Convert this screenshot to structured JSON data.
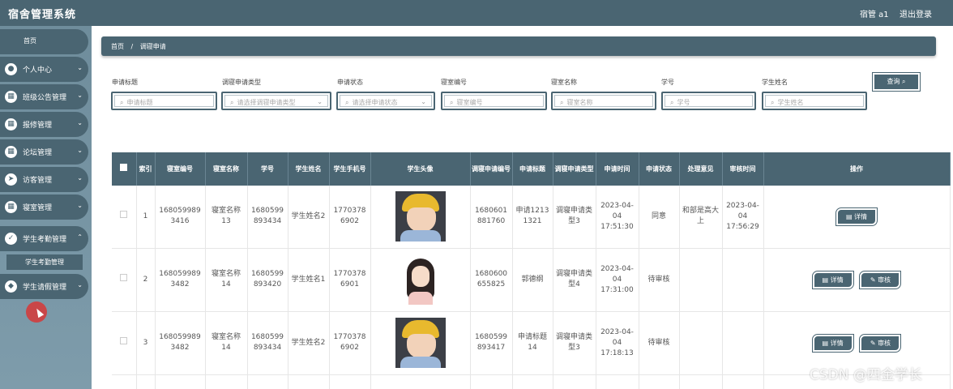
{
  "app": {
    "title": "宿舍管理系统",
    "user": "宿管 a1",
    "logout": "退出登录"
  },
  "sidebar": {
    "home": "首页",
    "items": [
      {
        "label": "个人中心",
        "icon": "person-icon"
      },
      {
        "label": "班级公告管理",
        "icon": "grid-icon"
      },
      {
        "label": "报修管理",
        "icon": "grid-icon"
      },
      {
        "label": "论坛管理",
        "icon": "grid-icon"
      },
      {
        "label": "访客管理",
        "icon": "send-icon"
      },
      {
        "label": "寝室管理",
        "icon": "grid-icon"
      },
      {
        "label": "学生考勤管理",
        "icon": "check-icon"
      },
      {
        "label": "学生请假管理",
        "icon": "shield-icon"
      }
    ],
    "submenu": "学生考勤管理"
  },
  "breadcrumb": {
    "home": "首页",
    "sep": "/",
    "current": "调寝申请"
  },
  "search": {
    "fields": [
      {
        "label": "申请标题",
        "placeholder": "申请标题"
      },
      {
        "label": "调寝申请类型",
        "placeholder": "请选择调寝申请类型"
      },
      {
        "label": "申请状态",
        "placeholder": "请选择申请状态"
      },
      {
        "label": "寝室编号",
        "placeholder": "寝室编号"
      },
      {
        "label": "寝室名称",
        "placeholder": "寝室名称"
      },
      {
        "label": "学号",
        "placeholder": "学号"
      },
      {
        "label": "学生姓名",
        "placeholder": "学生姓名"
      }
    ],
    "button": "查询"
  },
  "table": {
    "headers": [
      "索引",
      "寝室编号",
      "寝室名称",
      "学号",
      "学生姓名",
      "学生手机号",
      "学生头像",
      "调寝申请编号",
      "申请标题",
      "调寝申请类型",
      "申请时间",
      "申请状态",
      "处理意见",
      "审核时间",
      "操作"
    ],
    "rows": [
      {
        "index": "1",
        "room_no": "1680599893416",
        "room_name": "寝室名称13",
        "student_no": "1680599893434",
        "student_name": "学生姓名2",
        "phone": "17703786902",
        "avatar": "boy",
        "apply_no": "1680601881760",
        "title": "申请12131321",
        "type": "调寝申请类型3",
        "apply_time": "2023-04-04 17:51:30",
        "status": "同意",
        "opinion": "和部是高大上",
        "review_time": "2023-04-04 17:56:29",
        "actions": [
          "详情"
        ]
      },
      {
        "index": "2",
        "room_no": "1680599893482",
        "room_name": "寝室名称14",
        "student_no": "1680599893420",
        "student_name": "学生姓名1",
        "phone": "17703786901",
        "avatar": "girl",
        "apply_no": "1680600655825",
        "title": "郭德纲",
        "type": "调寝申请类型4",
        "apply_time": "2023-04-04 17:31:00",
        "status": "待审核",
        "opinion": "",
        "review_time": "",
        "actions": [
          "详情",
          "审核"
        ]
      },
      {
        "index": "3",
        "room_no": "1680599893482",
        "room_name": "寝室名称14",
        "student_no": "1680599893434",
        "student_name": "学生姓名2",
        "phone": "17703786902",
        "avatar": "boy",
        "apply_no": "1680599893417",
        "title": "申请标题14",
        "type": "调寝申请类型3",
        "apply_time": "2023-04-04 17:18:13",
        "status": "待审核",
        "opinion": "",
        "review_time": "",
        "actions": [
          "详情",
          "审核"
        ]
      }
    ]
  },
  "watermark": "CSDN @四金学长"
}
